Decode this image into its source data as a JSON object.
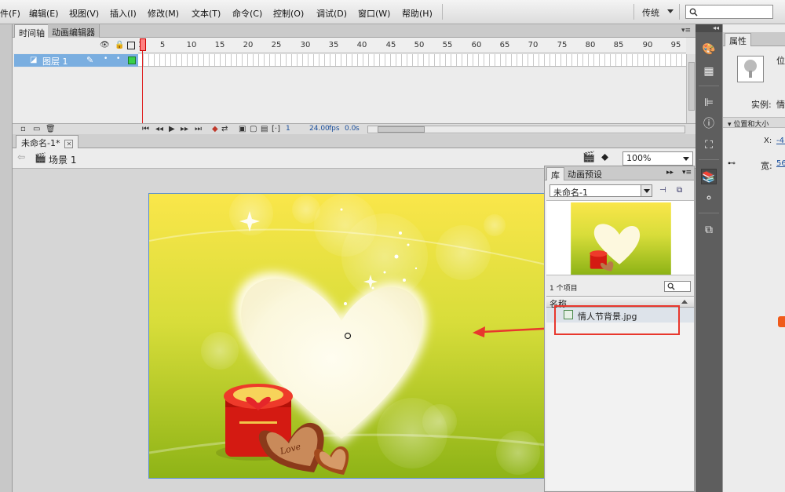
{
  "menubar": {
    "items": [
      "件(F)",
      "编辑(E)",
      "视图(V)",
      "插入(I)",
      "修改(M)",
      "文本(T)",
      "命令(C)",
      "控制(O)",
      "调试(D)",
      "窗口(W)",
      "帮助(H)"
    ],
    "workspace": "传统"
  },
  "timeline": {
    "tabs": [
      "时间轴",
      "动画编辑器"
    ],
    "layer_name": "图层 1",
    "frame_numbers": [
      "1",
      "5",
      "10",
      "15",
      "20",
      "25",
      "30",
      "35",
      "40",
      "45",
      "50",
      "55",
      "60",
      "65",
      "70",
      "75",
      "80",
      "85",
      "90",
      "95"
    ],
    "current_frame": "1",
    "fps": "24.00",
    "fps_unit": "fps",
    "time": "0.0",
    "time_unit": "s"
  },
  "document": {
    "tab_title": "未命名-1*",
    "scene": "场景 1",
    "zoom": "100%"
  },
  "library": {
    "tabs": [
      "库",
      "动画预设"
    ],
    "document_select": "未命名-1",
    "item_count": "1 个项目",
    "column_name": "名称",
    "items": [
      "情人节背景.jpg"
    ]
  },
  "properties": {
    "tab": "属性",
    "type_label": "位",
    "instance_label": "实例:",
    "instance_value": "情",
    "section": "位置和大小",
    "x_label": "X:",
    "x_value": "-4.",
    "width_label": "宽:",
    "width_value": "56"
  },
  "colors": {
    "accent_red": "#e8372d",
    "layer_selected": "#7aaee0",
    "panel_dark": "#5e5e5e"
  }
}
